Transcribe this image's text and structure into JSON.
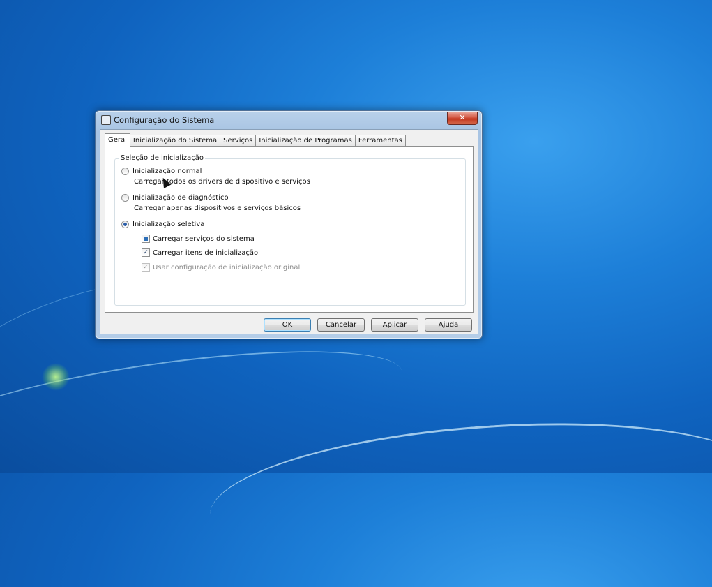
{
  "window": {
    "title": "Configuração do Sistema",
    "close_label": "✕"
  },
  "tabs": [
    {
      "label": "Geral"
    },
    {
      "label": "Inicialização do Sistema"
    },
    {
      "label": "Serviços"
    },
    {
      "label": "Inicialização de Programas"
    },
    {
      "label": "Ferramentas"
    }
  ],
  "active_tab": "Geral",
  "startup_selection": {
    "group_label": "Seleção de inicialização",
    "normal": {
      "label": "Inicialização normal",
      "description": "Carregar todos os drivers de dispositivo e serviços",
      "selected": false
    },
    "diagnostic": {
      "label": "Inicialização de diagnóstico",
      "description": "Carregar apenas dispositivos e serviços básicos",
      "selected": false
    },
    "selective": {
      "label": "Inicialização seletiva",
      "selected": true,
      "options": [
        {
          "label": "Carregar serviços do sistema",
          "state": "indeterminate"
        },
        {
          "label": "Carregar itens de inicialização",
          "state": "checked"
        },
        {
          "label": "Usar configuração de inicialização original",
          "state": "checked-disabled"
        }
      ]
    }
  },
  "buttons": {
    "ok": "OK",
    "cancel": "Cancelar",
    "apply": "Aplicar",
    "help": "Ajuda"
  },
  "colors": {
    "desktop_blue": "#1d7fd8",
    "close_red": "#c2381f",
    "radio_selected": "#2a5da8"
  },
  "icons": {
    "window_icon": "msconfig-icon",
    "close": "close-icon",
    "check": "checkmark-icon"
  }
}
